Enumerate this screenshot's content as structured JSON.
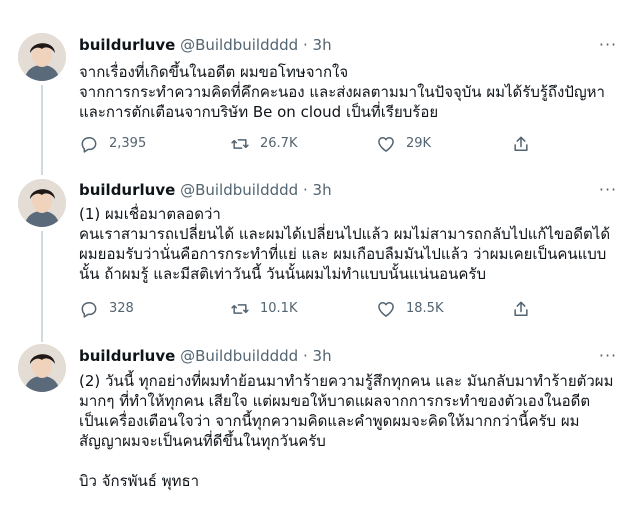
{
  "tweets": [
    {
      "name": "buildurluve",
      "handle": "@Buildbuildddd",
      "dot": "·",
      "time": "3h",
      "more": "···",
      "text": "จากเรื่องที่เกิดขึ้นในอดีต ผมขอโทษจากใจ\nจากการกระทำความคิดที่คึกคะนอง และส่งผลตามมาในปัจจุบัน ผมได้รับรู้ถึงปัญหา\nและการตักเตือนจากบริษัท Be on cloud เป็นที่เรียบร้อย",
      "stats": {
        "reply": "2,395",
        "retweet": "26.7K",
        "like": "29K"
      }
    },
    {
      "name": "buildurluve",
      "handle": "@Buildbuildddd",
      "dot": "·",
      "time": "3h",
      "more": "···",
      "text": "(1) ผมเชื่อมาตลอดว่า\nคนเราสามารถเปลี่ยนได้ และผมได้เปลี่ยนไปแล้ว ผมไม่สามารถกลับไปแก้ไขอดีตได้\nผมยอมรับว่านั่นคือการกระทำที่แย่ และ ผมเกือบลืมมันไปแล้ว ว่าผมเคยเป็นคนแบบ\nนั้น ถ้าผมรู้ และมีสติเท่าวันนี้ วันนั้นผมไม่ทำแบบนั้นแน่นอนครับ",
      "stats": {
        "reply": "328",
        "retweet": "10.1K",
        "like": "18.5K"
      }
    },
    {
      "name": "buildurluve",
      "handle": "@Buildbuildddd",
      "dot": "·",
      "time": "3h",
      "more": "···",
      "text": "(2) วันนี้ ทุกอย่างที่ผมทำย้อนมาทำร้ายความรู้สึกทุกคน และ มันกลับมาทำร้ายตัวผม\nมากๆ ที่ทำให้ทุกคน เสียใจ แต่ผมขอให้บาดแผลจากการกระทำของตัวเองในอดีต\nเป็นเครื่องเตือนใจว่า จากนี้ทุกความคิดและคำพูดผมจะคิดให้มากกว่านี้ครับ ผม\nสัญญาผมจะเป็นคนที่ดีขึ้นในทุกวันครับ\n\nบิว จักรพันธ์ พุทธา"
    }
  ]
}
